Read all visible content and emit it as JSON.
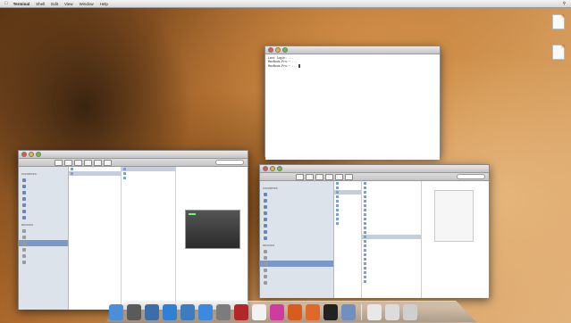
{
  "menubar": {
    "apple": "",
    "items": [
      "Terminal",
      "Shell",
      "Edit",
      "View",
      "Window",
      "Help"
    ],
    "right": [
      "",
      ""
    ]
  },
  "desktop_icons": [
    {
      "label": "",
      "icon": "document-icon"
    },
    {
      "label": "",
      "icon": "document-icon"
    }
  ],
  "terminal": {
    "title": "",
    "lines": [
      "Last login: ...",
      "MacBook-Pro:~ ...",
      "",
      "",
      "",
      "MacBook-Pro:~ ..."
    ]
  },
  "finder_left": {
    "title": "",
    "sidebar": [
      {
        "head": "FAVORITES"
      },
      {
        "label": "",
        "icon": "folder-icon"
      },
      {
        "label": "",
        "icon": "folder-icon"
      },
      {
        "label": "",
        "icon": "folder-icon"
      },
      {
        "label": "",
        "icon": "folder-icon"
      },
      {
        "label": "",
        "icon": "folder-icon"
      },
      {
        "label": "",
        "icon": "folder-icon"
      },
      {
        "label": "",
        "icon": "folder-icon"
      },
      {
        "head": "DEVICES"
      },
      {
        "label": "",
        "icon": "disk-icon"
      },
      {
        "label": "",
        "icon": "disk-icon"
      },
      {
        "label": "",
        "icon": "disk-icon",
        "selected": true
      },
      {
        "label": "",
        "icon": "disk-icon"
      },
      {
        "label": "",
        "icon": "disk-icon"
      },
      {
        "label": "",
        "icon": "disk-icon"
      }
    ],
    "col1": [
      "",
      ""
    ],
    "col2": [
      "",
      "",
      ""
    ],
    "meta": [
      "",
      "",
      "",
      "",
      "",
      ""
    ]
  },
  "finder_right": {
    "title": "",
    "sidebar": [
      {
        "head": "FAVORITES"
      },
      {
        "label": "",
        "icon": "folder-icon"
      },
      {
        "label": "",
        "icon": "folder-icon"
      },
      {
        "label": "",
        "icon": "folder-icon"
      },
      {
        "label": "",
        "icon": "folder-icon"
      },
      {
        "label": "",
        "icon": "folder-icon"
      },
      {
        "label": "",
        "icon": "folder-icon"
      },
      {
        "label": "",
        "icon": "folder-icon"
      },
      {
        "label": "",
        "icon": "folder-icon"
      },
      {
        "head": "DEVICES"
      },
      {
        "label": "",
        "icon": "disk-icon"
      },
      {
        "label": "",
        "icon": "disk-icon"
      },
      {
        "label": "",
        "icon": "disk-icon",
        "selected": true
      },
      {
        "label": "",
        "icon": "disk-icon"
      },
      {
        "label": "",
        "icon": "disk-icon"
      },
      {
        "label": "",
        "icon": "disk-icon"
      }
    ],
    "col1": [
      "",
      "",
      "",
      "",
      "",
      "",
      "",
      "",
      "",
      ""
    ],
    "col2": [
      "",
      "",
      "",
      "",
      "",
      "",
      "",
      "",
      "",
      "",
      "",
      "",
      "",
      "",
      "",
      "",
      "",
      "",
      "",
      "",
      "",
      "",
      ""
    ],
    "meta": [
      "",
      "",
      "",
      "",
      "",
      ""
    ]
  },
  "dock": {
    "icons": [
      {
        "name": "finder-icon",
        "color": "#4a8fd9"
      },
      {
        "name": "launchpad-icon",
        "color": "#5a5a5a"
      },
      {
        "name": "mission-control-icon",
        "color": "#3b6ea8"
      },
      {
        "name": "app-store-icon",
        "color": "#2f7fd4"
      },
      {
        "name": "mail-icon",
        "color": "#3e7cc2"
      },
      {
        "name": "safari-icon",
        "color": "#3a8be0"
      },
      {
        "name": "system-preferences-icon",
        "color": "#7c7c7c"
      },
      {
        "name": "photo-booth-icon",
        "color": "#b3272a"
      },
      {
        "name": "calendar-icon",
        "color": "#f2f2f2"
      },
      {
        "name": "itunes-icon",
        "color": "#cf3b9e"
      },
      {
        "name": "ibooks-icon",
        "color": "#d95b1e"
      },
      {
        "name": "firefox-icon",
        "color": "#e0682a"
      },
      {
        "name": "terminal-icon",
        "color": "#222222"
      },
      {
        "name": "preview-icon",
        "color": "#6f90c0"
      },
      {
        "name": "documents-stack-icon",
        "color": "#e8e8e8"
      },
      {
        "name": "downloads-stack-icon",
        "color": "#dcdcdc"
      },
      {
        "name": "trash-icon",
        "color": "#cfcfcf"
      }
    ]
  }
}
